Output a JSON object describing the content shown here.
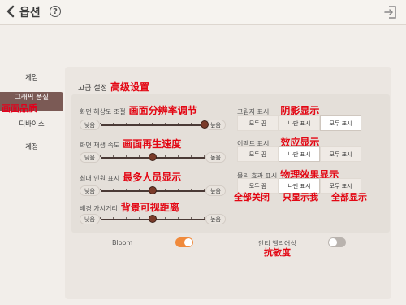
{
  "header": {
    "title": "옵션",
    "help_glyph": "?",
    "icons": [
      "back-arrow-icon",
      "exit-icon"
    ]
  },
  "sidebar": {
    "items": [
      {
        "label": "게임"
      },
      {
        "label": "그래픽 품질",
        "annotation": "画面品质",
        "active": true
      },
      {
        "label": "디바이스"
      },
      {
        "label": "계정"
      }
    ]
  },
  "advanced": {
    "title": "고급 설정",
    "annotation": "高级设置"
  },
  "sliders": [
    {
      "label": "화면 해상도 조절",
      "annotation": "画面分辨率调节",
      "min_label": "낮음",
      "max_label": "높음",
      "level": 1.0
    },
    {
      "label": "화면 재생 속도",
      "annotation": "画面再生速度",
      "min_label": "낮음",
      "max_label": "높음",
      "level": 0.5
    },
    {
      "label": "최대 인원 표시",
      "annotation": "最多人员显示",
      "min_label": "낮음",
      "max_label": "높음",
      "level": 0.5
    },
    {
      "label": "배경 가시거리",
      "annotation": "背景可视距离",
      "min_label": "낮음",
      "max_label": "높음",
      "level": 0.5
    }
  ],
  "options": [
    {
      "label": "그림자 표시",
      "annotation": "阴影显示",
      "choices": [
        "모두 끔",
        "나만 표시",
        "모두 표시"
      ],
      "selected": 2
    },
    {
      "label": "이펙트 표시",
      "annotation": "效应显示",
      "choices": [
        "모두 끔",
        "나만 표시",
        "모두 표시"
      ],
      "selected": 1
    },
    {
      "label": "물리 효과 표시",
      "annotation": "物理效果显示",
      "choices": [
        "모두 끔",
        "나만 표시",
        "모두 표시"
      ],
      "selected": 1
    }
  ],
  "choice_annotations": [
    "全部关闭",
    "只显示我",
    "全部显示"
  ],
  "toggles": [
    {
      "label": "Bloom",
      "on": true
    },
    {
      "label": "안티 엘리어싱",
      "annotation": "抗敏度",
      "on": false
    }
  ],
  "colors": {
    "accent": "#f08a3c",
    "knob": "#7a3b2a",
    "active_tab": "#7b5a55",
    "annotation_red": "#e30613"
  }
}
